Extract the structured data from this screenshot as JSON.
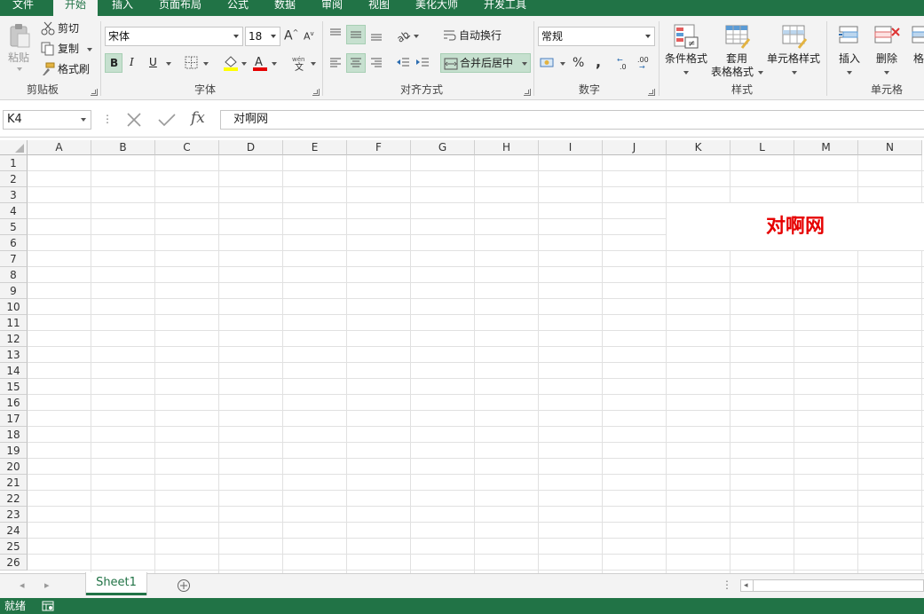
{
  "tabs": [
    "文件",
    "开始",
    "插入",
    "页面布局",
    "公式",
    "数据",
    "审阅",
    "视图",
    "美化大师",
    "开发工具"
  ],
  "active_tab": "开始",
  "clipboard": {
    "paste": "粘贴",
    "cut": "剪切",
    "copy": "复制",
    "format_painter": "格式刷",
    "group": "剪贴板"
  },
  "font": {
    "name": "宋体",
    "size": "18",
    "bold": "B",
    "italic": "I",
    "underline": "U",
    "group": "字体"
  },
  "alignment": {
    "wrap_text": "自动换行",
    "merge_center": "合并后居中",
    "group": "对齐方式"
  },
  "number": {
    "format": "常规",
    "percent": "%",
    "comma": ",",
    "group": "数字"
  },
  "styles": {
    "conditional": "条件格式",
    "table_line1": "套用",
    "table_line2": "表格格式",
    "cell_styles": "单元格样式",
    "group": "样式"
  },
  "cells": {
    "insert": "插入",
    "delete": "删除",
    "format": "格",
    "group": "单元格"
  },
  "name_box": "K4",
  "formula_value": "对啊网",
  "fx": "fx",
  "columns": [
    "A",
    "B",
    "C",
    "D",
    "E",
    "F",
    "G",
    "H",
    "I",
    "J",
    "K",
    "L",
    "M",
    "N"
  ],
  "rows": [
    "1",
    "2",
    "3",
    "4",
    "5",
    "6",
    "7",
    "8",
    "9",
    "10",
    "11",
    "12",
    "13",
    "14",
    "15",
    "16",
    "17",
    "18",
    "19",
    "20",
    "21",
    "22",
    "23",
    "24",
    "25",
    "26"
  ],
  "merged_cell_text": "对啊网",
  "sheet_tab": "Sheet1",
  "status_text": "就绪",
  "colors": {
    "accent": "#217346",
    "cell_text": "#e60000"
  }
}
